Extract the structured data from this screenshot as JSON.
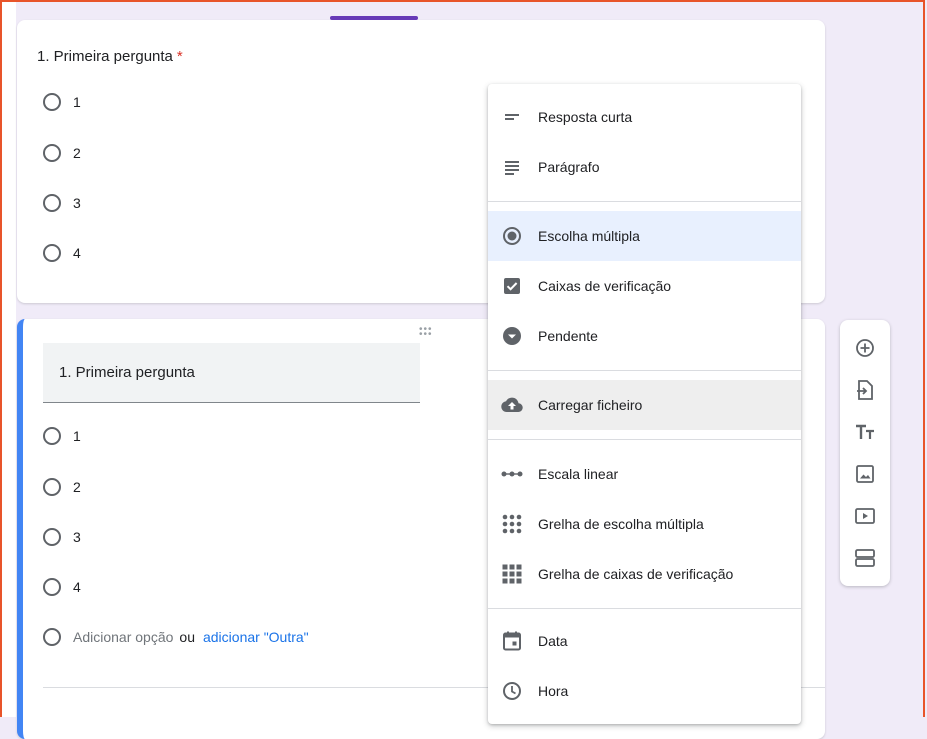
{
  "question1": {
    "title": "1. Primeira pergunta",
    "required_mark": "*",
    "options": [
      "1",
      "2",
      "3",
      "4"
    ]
  },
  "question2": {
    "title": "1. Primeira pergunta",
    "options": [
      "1",
      "2",
      "3",
      "4"
    ],
    "add_option": "Adicionar opção",
    "or": "ou",
    "add_other": "adicionar \"Outra\""
  },
  "menu": {
    "items": [
      {
        "label": "Resposta curta",
        "icon": "short-answer-icon"
      },
      {
        "label": "Parágrafo",
        "icon": "paragraph-icon"
      },
      {
        "label": "Escolha múltipla",
        "icon": "radio-checked-icon",
        "selected": true
      },
      {
        "label": "Caixas de verificação",
        "icon": "checkbox-icon"
      },
      {
        "label": "Pendente",
        "icon": "dropdown-icon"
      },
      {
        "label": "Carregar ficheiro",
        "icon": "cloud-upload-icon",
        "hover": true
      },
      {
        "label": "Escala linear",
        "icon": "linear-scale-icon"
      },
      {
        "label": "Grelha de escolha múltipla",
        "icon": "multiple-choice-grid-icon"
      },
      {
        "label": "Grelha de caixas de verificação",
        "icon": "checkbox-grid-icon"
      },
      {
        "label": "Data",
        "icon": "calendar-icon"
      },
      {
        "label": "Hora",
        "icon": "clock-icon"
      }
    ]
  },
  "toolbar": {
    "items": [
      "add-question-icon",
      "import-questions-icon",
      "add-title-icon",
      "add-image-icon",
      "add-video-icon",
      "add-section-icon"
    ]
  },
  "colors": {
    "accent": "#673ab7",
    "active_border": "#4285f4",
    "link": "#1a73e8",
    "required": "#d93025",
    "frame": "#e8542a"
  }
}
